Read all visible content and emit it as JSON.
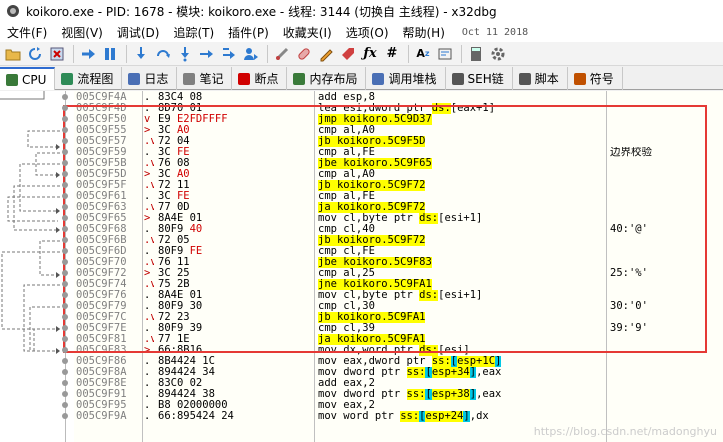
{
  "window": {
    "title": "koikoro.exe - PID: 1678 - 模块: koikoro.exe - 线程: 3144 (切换自 主线程) - x32dbg"
  },
  "menu": {
    "items": [
      "文件(F)",
      "视图(V)",
      "调试(D)",
      "追踪(T)",
      "插件(P)",
      "收藏夹(I)",
      "选项(O)",
      "帮助(H)"
    ],
    "date": "Oct 11 2018"
  },
  "toolbar": {
    "buttons": [
      "open-icon",
      "restart-icon",
      "close-icon",
      "run-icon",
      "pause-icon",
      "step-into-icon",
      "step-over-icon",
      "trace-into-icon",
      "trace-over-icon",
      "execute-till-return-icon",
      "run-to-user-code-icon",
      "scylla-icon",
      "patch-icon",
      "comment-icon",
      "label-icon",
      "bookmark-icon",
      "function-icon",
      "hash-icon",
      "font-icon",
      "calculator-icon",
      "settings-icon"
    ]
  },
  "tabs": [
    {
      "label": "CPU",
      "icon": "cpu-icon",
      "color": "#3a7a3a",
      "active": true
    },
    {
      "label": "流程图",
      "icon": "graph-icon",
      "color": "#2e8b57"
    },
    {
      "label": "日志",
      "icon": "log-icon",
      "color": "#4a6fb5"
    },
    {
      "label": "笔记",
      "icon": "notes-icon",
      "color": "#808080"
    },
    {
      "label": "断点",
      "icon": "breakpoint-icon",
      "color": "#d00000"
    },
    {
      "label": "内存布局",
      "icon": "memory-map-icon",
      "color": "#3a7a3a"
    },
    {
      "label": "调用堆栈",
      "icon": "call-stack-icon",
      "color": "#4a6fb5"
    },
    {
      "label": "SEH链",
      "icon": "seh-icon",
      "color": "#555555"
    },
    {
      "label": "脚本",
      "icon": "script-icon",
      "color": "#555555"
    },
    {
      "label": "符号",
      "icon": "symbols-icon",
      "color": "#c05000"
    }
  ],
  "rows": [
    {
      "addr": "005C9F4A",
      "mark": ".",
      "bytes": "83C4 08",
      "instr": [
        {
          "t": "add esp,8"
        }
      ],
      "comment": ""
    },
    {
      "addr": "005C9F4D",
      "mark": ".",
      "bytes": "8D70 01",
      "instr": [
        {
          "t": "lea esi,dword ptr "
        },
        {
          "t": "ds:",
          "hl": "y"
        },
        {
          "t": "[eax+1]"
        }
      ],
      "comment": ""
    },
    {
      "addr": "005C9F50",
      "mark": "v",
      "bytes": "E9 E2FDFFFF",
      "instr": [
        {
          "t": "jmp koikoro.5C9D37",
          "hl": "y"
        }
      ],
      "comment": "",
      "bred": true
    },
    {
      "addr": "005C9F55",
      "mark": ">",
      "bytes": "3C A0",
      "instr": [
        {
          "t": "cmp al,A0"
        }
      ],
      "comment": "",
      "bred": true
    },
    {
      "addr": "005C9F57",
      "mark": ".v",
      "bytes": "72 04",
      "instr": [
        {
          "t": "jb koikoro.5C9F5D",
          "hl": "y"
        }
      ],
      "comment": ""
    },
    {
      "addr": "005C9F59",
      "mark": ".",
      "bytes": "3C FE",
      "instr": [
        {
          "t": "cmp al,FE"
        }
      ],
      "comment": "边界校验",
      "bred": true
    },
    {
      "addr": "005C9F5B",
      "mark": ".v",
      "bytes": "76 08",
      "instr": [
        {
          "t": "jbe koikoro.5C9F65",
          "hl": "y"
        }
      ],
      "comment": ""
    },
    {
      "addr": "005C9F5D",
      "mark": ">",
      "bytes": "3C A0",
      "instr": [
        {
          "t": "cmp al,A0"
        }
      ],
      "comment": "",
      "bred": true
    },
    {
      "addr": "005C9F5F",
      "mark": ".v",
      "bytes": "72 11",
      "instr": [
        {
          "t": "jb koikoro.5C9F72",
          "hl": "y"
        }
      ],
      "comment": ""
    },
    {
      "addr": "005C9F61",
      "mark": ".",
      "bytes": "3C FE",
      "instr": [
        {
          "t": "cmp al,FE"
        }
      ],
      "comment": "",
      "bred": true
    },
    {
      "addr": "005C9F63",
      "mark": ".v",
      "bytes": "77 0D",
      "instr": [
        {
          "t": "ja koikoro.5C9F72",
          "hl": "y"
        }
      ],
      "comment": ""
    },
    {
      "addr": "005C9F65",
      "mark": ">",
      "bytes": "8A4E 01",
      "instr": [
        {
          "t": "mov cl,byte ptr "
        },
        {
          "t": "ds:",
          "hl": "y"
        },
        {
          "t": "[esi+1]"
        }
      ],
      "comment": ""
    },
    {
      "addr": "005C9F68",
      "mark": ".",
      "bytes": "80F9 40",
      "instr": [
        {
          "t": "cmp cl,40"
        }
      ],
      "comment": "40:'@'",
      "bred": true
    },
    {
      "addr": "005C9F6B",
      "mark": ".v",
      "bytes": "72 05",
      "instr": [
        {
          "t": "jb koikoro.5C9F72",
          "hl": "y"
        }
      ],
      "comment": ""
    },
    {
      "addr": "005C9F6D",
      "mark": ".",
      "bytes": "80F9 FE",
      "instr": [
        {
          "t": "cmp cl,FE"
        }
      ],
      "comment": "",
      "bred": true
    },
    {
      "addr": "005C9F70",
      "mark": ".v",
      "bytes": "76 11",
      "instr": [
        {
          "t": "jbe koikoro.5C9F83",
          "hl": "y"
        }
      ],
      "comment": ""
    },
    {
      "addr": "005C9F72",
      "mark": ">",
      "bytes": "3C 25",
      "instr": [
        {
          "t": "cmp al,25"
        }
      ],
      "comment": "25:'%'"
    },
    {
      "addr": "005C9F74",
      "mark": ".v",
      "bytes": "75 2B",
      "instr": [
        {
          "t": "jne koikoro.5C9FA1",
          "hl": "y"
        }
      ],
      "comment": ""
    },
    {
      "addr": "005C9F76",
      "mark": ".",
      "bytes": "8A4E 01",
      "instr": [
        {
          "t": "mov cl,byte ptr "
        },
        {
          "t": "ds:",
          "hl": "y"
        },
        {
          "t": "[esi+1]"
        }
      ],
      "comment": ""
    },
    {
      "addr": "005C9F79",
      "mark": ".",
      "bytes": "80F9 30",
      "instr": [
        {
          "t": "cmp cl,30"
        }
      ],
      "comment": "30:'0'"
    },
    {
      "addr": "005C9F7C",
      "mark": ".v",
      "bytes": "72 23",
      "instr": [
        {
          "t": "jb koikoro.5C9FA1",
          "hl": "y"
        }
      ],
      "comment": ""
    },
    {
      "addr": "005C9F7E",
      "mark": ".",
      "bytes": "80F9 39",
      "instr": [
        {
          "t": "cmp cl,39"
        }
      ],
      "comment": "39:'9'"
    },
    {
      "addr": "005C9F81",
      "mark": ".v",
      "bytes": "77 1E",
      "instr": [
        {
          "t": "ja koikoro.5C9FA1",
          "hl": "y"
        }
      ],
      "comment": ""
    },
    {
      "addr": "005C9F83",
      "mark": ">",
      "bytes": "66:8B16",
      "instr": [
        {
          "t": "mov dx,word ptr "
        },
        {
          "t": "ds:",
          "hl": "y"
        },
        {
          "t": "[esi]"
        }
      ],
      "comment": ""
    },
    {
      "addr": "005C9F86",
      "mark": ".",
      "bytes": "8B4424 1C",
      "instr": [
        {
          "t": "mov eax,dword ptr "
        },
        {
          "t": "ss:",
          "hl": "y"
        },
        {
          "t": "[",
          "hl": "c"
        },
        {
          "t": "esp+1C",
          "hl": "y"
        },
        {
          "t": "]",
          "hl": "c"
        }
      ],
      "comment": ""
    },
    {
      "addr": "005C9F8A",
      "mark": ".",
      "bytes": "894424 34",
      "instr": [
        {
          "t": "mov dword ptr "
        },
        {
          "t": "ss:",
          "hl": "y"
        },
        {
          "t": "[",
          "hl": "c"
        },
        {
          "t": "esp+34",
          "hl": "y"
        },
        {
          "t": "]",
          "hl": "c"
        },
        {
          "t": ",eax"
        }
      ],
      "comment": ""
    },
    {
      "addr": "005C9F8E",
      "mark": ".",
      "bytes": "83C0 02",
      "instr": [
        {
          "t": "add eax,2"
        }
      ],
      "comment": ""
    },
    {
      "addr": "005C9F91",
      "mark": ".",
      "bytes": "894424 38",
      "instr": [
        {
          "t": "mov dword ptr "
        },
        {
          "t": "ss:",
          "hl": "y"
        },
        {
          "t": "[",
          "hl": "c"
        },
        {
          "t": "esp+38",
          "hl": "y"
        },
        {
          "t": "]",
          "hl": "c"
        },
        {
          "t": ",eax"
        }
      ],
      "comment": ""
    },
    {
      "addr": "005C9F95",
      "mark": ".",
      "bytes": "B8 02000000",
      "instr": [
        {
          "t": "mov eax,2"
        }
      ],
      "comment": ""
    },
    {
      "addr": "005C9F9A",
      "mark": ".",
      "bytes": "66:895424 24",
      "instr": [
        {
          "t": "mov word ptr "
        },
        {
          "t": "ss:",
          "hl": "y"
        },
        {
          "t": "[",
          "hl": "c"
        },
        {
          "t": "esp+24",
          "hl": "y"
        },
        {
          "t": "]",
          "hl": "c"
        },
        {
          "t": ",dx"
        }
      ],
      "comment": ""
    }
  ],
  "watermark": "https://blog.csdn.net/madonghyu"
}
